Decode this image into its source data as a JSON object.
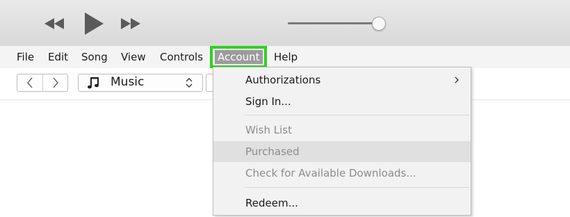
{
  "player": {
    "rewind_icon": "rewind-icon",
    "play_icon": "play-icon",
    "fast_forward_icon": "fast-forward-icon",
    "volume_level": 0.9
  },
  "menu_bar": {
    "items": [
      "File",
      "Edit",
      "Song",
      "View",
      "Controls",
      "Account",
      "Help"
    ],
    "selected": "Account"
  },
  "toolbar": {
    "back_icon": "chevron-left-icon",
    "forward_icon": "chevron-right-icon",
    "media_select": {
      "icon": "music-note-icon",
      "value": "Music"
    }
  },
  "account_menu": {
    "items": [
      {
        "label": "Authorizations",
        "enabled": true,
        "submenu": true
      },
      {
        "label": "Sign In...",
        "enabled": true
      },
      {
        "label": "Wish List",
        "enabled": false
      },
      {
        "label": "Purchased",
        "enabled": false,
        "hovered": true
      },
      {
        "label": "Check for Available Downloads...",
        "enabled": false
      },
      {
        "label": "Redeem...",
        "enabled": true
      }
    ]
  },
  "colors": {
    "highlight_border": "#2fd11f",
    "menu_selected_bg": "#9c9c9c"
  }
}
